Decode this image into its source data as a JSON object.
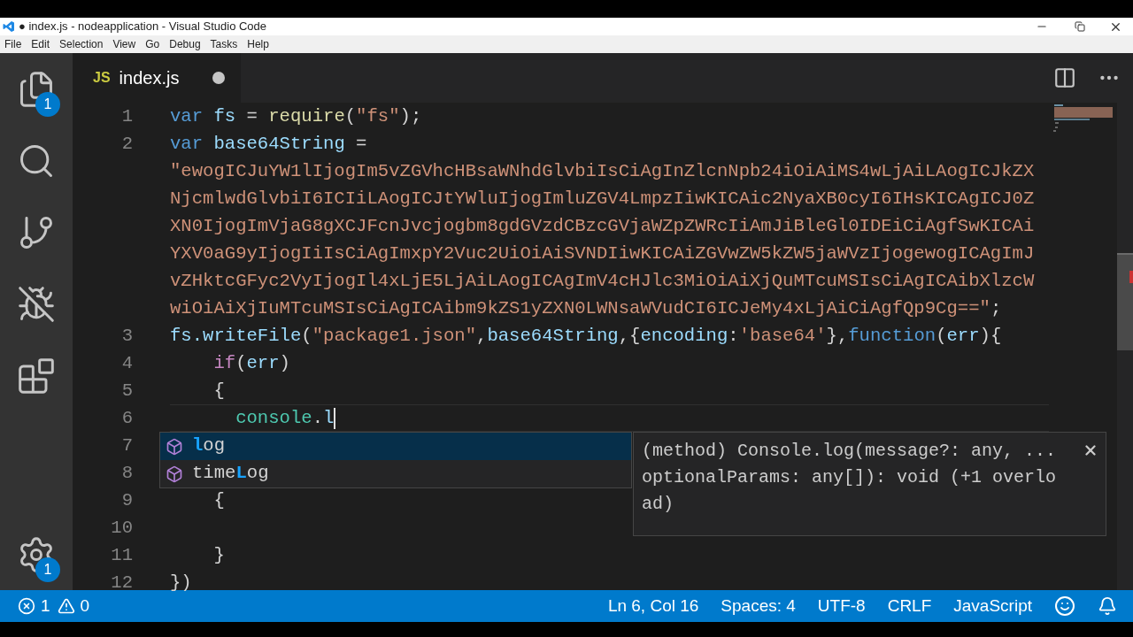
{
  "window": {
    "title": "● index.js - nodeapplication - Visual Studio Code"
  },
  "menu": [
    "File",
    "Edit",
    "Selection",
    "View",
    "Go",
    "Debug",
    "Tasks",
    "Help"
  ],
  "activity_bar": [
    {
      "kind": "files",
      "badge": "1"
    },
    {
      "kind": "search"
    },
    {
      "kind": "git"
    },
    {
      "kind": "debug"
    },
    {
      "kind": "extensions"
    },
    {
      "kind": "settings",
      "badge": "1"
    }
  ],
  "tabs": [
    {
      "badge": "JS",
      "label": "index.js",
      "selected": true,
      "modified": true
    }
  ],
  "editor": {
    "lines": [
      {
        "number": "1",
        "tokens": [
          {
            "kind": "keyword",
            "text": "var"
          },
          {
            "kind": "variable",
            "text": " fs"
          },
          {
            "kind": "plain",
            "text": " = "
          },
          {
            "kind": "function",
            "text": "require"
          },
          {
            "kind": "plain",
            "text": "("
          },
          {
            "kind": "string",
            "text": "\"fs\""
          },
          {
            "kind": "plain",
            "text": ");"
          }
        ]
      },
      {
        "number": "2",
        "tokens": [
          {
            "kind": "keyword",
            "text": "var"
          },
          {
            "kind": "variable",
            "text": " base64String"
          },
          {
            "kind": "plain",
            "text": " ="
          }
        ]
      },
      {
        "tokens": [
          {
            "kind": "string",
            "text": "\"ewogICJuYW1lIjogIm5vZGVhcHBsaWNhdGlvbiIsCiAgInZlcnNpb24iOiAiMS4wLjAiLAogICJkZX"
          }
        ]
      },
      {
        "tokens": [
          {
            "kind": "string",
            "text": "NjcmlwdGlvbiI6ICIiLAogICJtYWluIjogImluZGV4LmpzIiwKICAic2NyaXB0cyI6IHsKICAgICJ0Z"
          }
        ]
      },
      {
        "tokens": [
          {
            "kind": "string",
            "text": "XN0IjogImVjaG8gXCJFcnJvcjogbm8gdGVzdCBzcGVjaWZpZWRcIiAmJiBleGl0IDEiCiAgfSwKICAi"
          }
        ]
      },
      {
        "tokens": [
          {
            "kind": "string",
            "text": "YXV0aG9yIjogIiIsCiAgImxpY2Vuc2UiOiAiSVNDIiwKICAiZGVwZW5kZW5jaWVzIjogewogICAgImJ"
          }
        ]
      },
      {
        "tokens": [
          {
            "kind": "string",
            "text": "vZHktcGFyc2VyIjogIl4xLjE5LjAiLAogICAgImV4cHJlc3MiOiAiXjQuMTcuMSIsCiAgICAibXlzcW"
          }
        ]
      },
      {
        "tokens": [
          {
            "kind": "string",
            "text": "wiOiAiXjIuMTcuMSIsCiAgICAibm9kZS1yZXN0LWNsaWVudCI6ICJeMy4xLjAiCiAgfQp9Cg==\""
          },
          {
            "kind": "plain",
            "text": ";"
          }
        ]
      },
      {
        "number": "3",
        "tokens": [
          {
            "kind": "variable",
            "text": "fs.writeFile"
          },
          {
            "kind": "plain",
            "text": "("
          },
          {
            "kind": "string",
            "text": "\"package1.json\""
          },
          {
            "kind": "plain",
            "text": ","
          },
          {
            "kind": "variable",
            "text": "base64String"
          },
          {
            "kind": "plain",
            "text": ",{"
          },
          {
            "kind": "variable",
            "text": "encoding"
          },
          {
            "kind": "plain",
            "text": ":"
          },
          {
            "kind": "string",
            "text": "'base64'"
          },
          {
            "kind": "plain",
            "text": "},"
          },
          {
            "kind": "keyword",
            "text": "function"
          },
          {
            "kind": "plain",
            "text": "("
          },
          {
            "kind": "variable",
            "text": "err"
          },
          {
            "kind": "plain",
            "text": "){"
          }
        ]
      },
      {
        "number": "4",
        "tokens": [
          {
            "kind": "control",
            "text": "    if"
          },
          {
            "kind": "plain",
            "text": "("
          },
          {
            "kind": "variable",
            "text": "err"
          },
          {
            "kind": "plain",
            "text": ")"
          }
        ]
      },
      {
        "number": "5",
        "tokens": [
          {
            "kind": "plain",
            "text": "    {"
          }
        ]
      },
      {
        "number": "6",
        "current": true,
        "tokens": [
          {
            "kind": "class",
            "text": "      console"
          },
          {
            "kind": "plain",
            "text": "."
          },
          {
            "kind": "variable",
            "text": "l"
          }
        ]
      },
      {
        "number": "7"
      },
      {
        "number": "8"
      },
      {
        "number": "9",
        "tokens": [
          {
            "kind": "plain",
            "text": "    {"
          }
        ]
      },
      {
        "number": "10"
      },
      {
        "number": "11",
        "tokens": [
          {
            "kind": "plain",
            "text": "    }"
          }
        ]
      },
      {
        "number": "12",
        "tokens": [
          {
            "kind": "plain",
            "text": "})"
          }
        ]
      }
    ]
  },
  "suggestions": [
    {
      "parts": [
        {
          "text": "l",
          "match": true
        },
        {
          "text": "og",
          "match": false
        }
      ],
      "selected": true
    },
    {
      "parts": [
        {
          "text": "time",
          "match": false
        },
        {
          "text": "L",
          "match": true
        },
        {
          "text": "og",
          "match": false
        }
      ],
      "selected": false
    }
  ],
  "details": "(method) Console.log(message?: any, ...optionalParams: any[]): void (+1 overload)",
  "status_bar": {
    "errors": "1",
    "warnings": "0",
    "items": [
      "Ln 6, Col 16",
      "Spaces: 4",
      "UTF-8",
      "CRLF",
      "JavaScript"
    ]
  }
}
